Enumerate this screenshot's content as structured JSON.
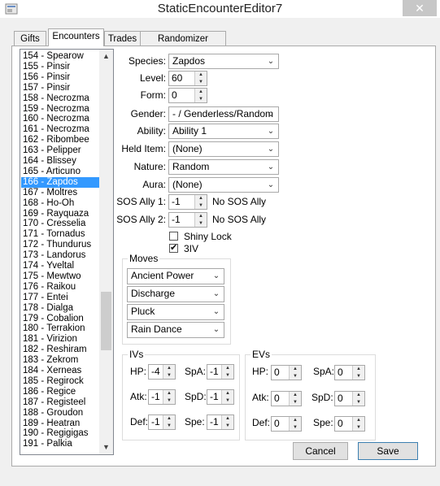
{
  "window": {
    "title": "StaticEncounterEditor7",
    "close_glyph": "✕",
    "app_icon": "app-icon"
  },
  "tabs": [
    {
      "label": "Gifts",
      "active": false
    },
    {
      "label": "Encounters",
      "active": true
    },
    {
      "label": "Trades",
      "active": false
    },
    {
      "label": "Randomizer Options",
      "active": false
    }
  ],
  "species_list": {
    "items": [
      "154 - Spearow",
      "155 - Pinsir",
      "156 - Pinsir",
      "157 - Pinsir",
      "158 - Necrozma",
      "159 - Necrozma",
      "160 - Necrozma",
      "161 - Necrozma",
      "162 - Ribombee",
      "163 - Pelipper",
      "164 - Blissey",
      "165 - Articuno",
      "166 - Zapdos",
      "167 - Moltres",
      "168 - Ho-Oh",
      "169 - Rayquaza",
      "170 - Cresselia",
      "171 - Tornadus",
      "172 - Thundurus",
      "173 - Landorus",
      "174 - Yveltal",
      "175 - Mewtwo",
      "176 - Raikou",
      "177 - Entei",
      "178 - Dialga",
      "179 - Cobalion",
      "180 - Terrakion",
      "181 - Virizion",
      "182 - Reshiram",
      "183 - Zekrom",
      "184 - Xerneas",
      "185 - Regirock",
      "186 - Regice",
      "187 - Registeel",
      "188 - Groudon",
      "189 - Heatran",
      "190 - Regigigas",
      "191 - Palkia"
    ],
    "selected_index": 12
  },
  "form": {
    "species": {
      "label": "Species:",
      "value": "Zapdos"
    },
    "level": {
      "label": "Level:",
      "value": "60"
    },
    "form": {
      "label": "Form:",
      "value": "0"
    },
    "gender": {
      "label": "Gender:",
      "value": "- / Genderless/Random"
    },
    "ability": {
      "label": "Ability:",
      "value": "Ability 1"
    },
    "held_item": {
      "label": "Held Item:",
      "value": "(None)"
    },
    "nature": {
      "label": "Nature:",
      "value": "Random"
    },
    "aura": {
      "label": "Aura:",
      "value": "(None)"
    },
    "sos1": {
      "label": "SOS Ally 1:",
      "value": "-1",
      "text": "No SOS Ally"
    },
    "sos2": {
      "label": "SOS Ally 2:",
      "value": "-1",
      "text": "No SOS Ally"
    },
    "shiny_lock": {
      "label": "Shiny Lock",
      "checked": false
    },
    "three_iv": {
      "label": "3IV",
      "checked": true,
      "check_glyph": "✔"
    }
  },
  "moves": {
    "title": "Moves",
    "values": [
      "Ancient Power",
      "Discharge",
      "Pluck",
      "Rain Dance"
    ]
  },
  "ivs": {
    "title": "IVs",
    "hp": {
      "label": "HP:",
      "value": "-4"
    },
    "atk": {
      "label": "Atk:",
      "value": "-1"
    },
    "def": {
      "label": "Def:",
      "value": "-1"
    },
    "spa": {
      "label": "SpA:",
      "value": "-1"
    },
    "spd": {
      "label": "SpD:",
      "value": "-1"
    },
    "spe": {
      "label": "Spe:",
      "value": "-1"
    }
  },
  "evs": {
    "title": "EVs",
    "hp": {
      "label": "HP:",
      "value": "0"
    },
    "atk": {
      "label": "Atk:",
      "value": "0"
    },
    "def": {
      "label": "Def:",
      "value": "0"
    },
    "spa": {
      "label": "SpA:",
      "value": "0"
    },
    "spd": {
      "label": "SpD:",
      "value": "0"
    },
    "spe": {
      "label": "Spe:",
      "value": "0"
    }
  },
  "buttons": {
    "cancel": "Cancel",
    "save": "Save"
  },
  "glyphs": {
    "dropdown": "⌄",
    "spin_up": "▲",
    "spin_down": "▼",
    "scroll_up": "▲",
    "scroll_down": "▼"
  }
}
